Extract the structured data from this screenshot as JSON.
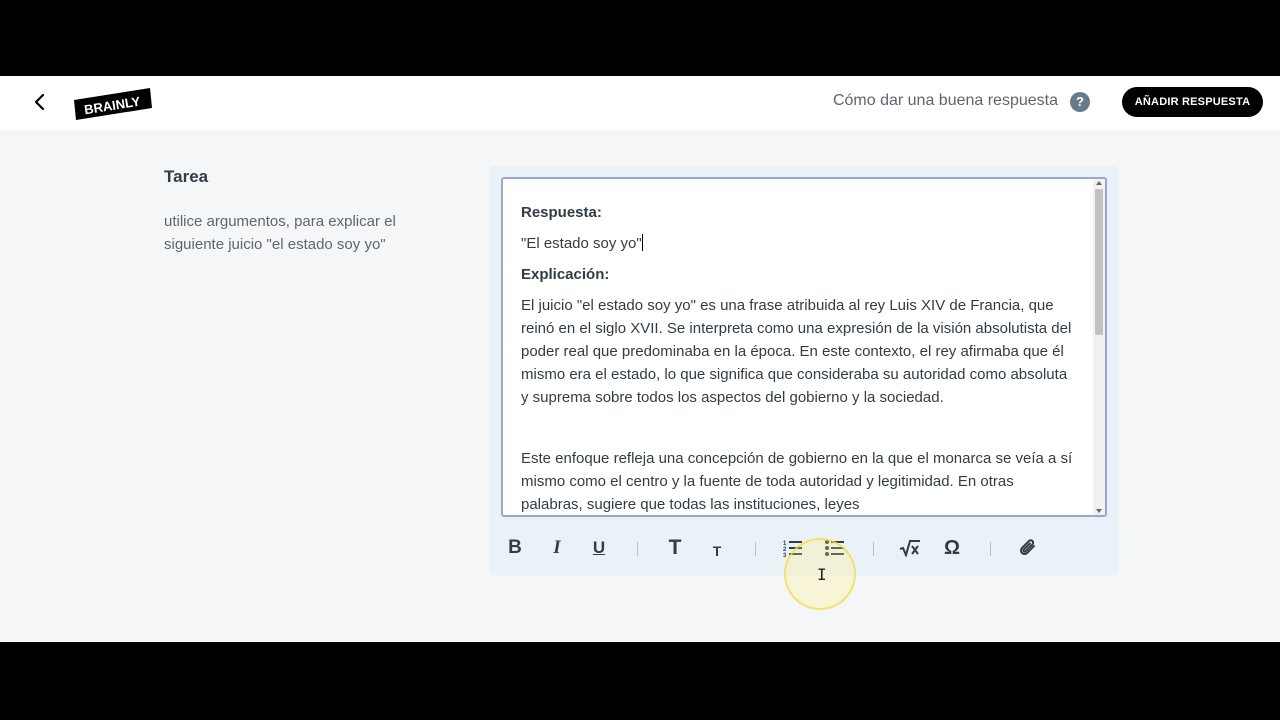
{
  "header": {
    "logo_text": "BRAINLY",
    "help_text": "Cómo dar una buena respuesta",
    "help_icon": "?",
    "add_answer_button": "AÑADIR RESPUESTA"
  },
  "task": {
    "title": "Tarea",
    "question": "utilice argumentos, para explicar el siguiente juicio \"el estado soy yo\""
  },
  "editor": {
    "answer_label": "Respuesta:",
    "answer_value": "\"El estado soy yo\"",
    "explanation_label": "Explicación:",
    "paragraph_1": "El juicio \"el estado soy yo\" es una frase atribuida al rey Luis XIV de Francia, que reinó en el siglo XVII. Se interpreta como una expresión de la visión absolutista del poder real que predominaba en la época. En este contexto, el rey afirmaba que él mismo era el estado, lo que significa que consideraba su autoridad como absoluta y suprema sobre todos los aspectos del gobierno y la sociedad.",
    "paragraph_2": "Este enfoque refleja una concepción de gobierno en la que el monarca se veía a sí mismo como el centro y la fuente de toda autoridad y legitimidad. En otras palabras, sugiere que todas las instituciones, leyes"
  },
  "toolbar": {
    "bold": "B",
    "italic": "I",
    "underline": "U",
    "text_large": "T",
    "text_small": "T",
    "omega": "Ω"
  },
  "colors": {
    "accent_dark": "#000000",
    "text": "#323c45",
    "editor_border": "#9aa7d6",
    "page_bg": "#f5f6f7"
  }
}
